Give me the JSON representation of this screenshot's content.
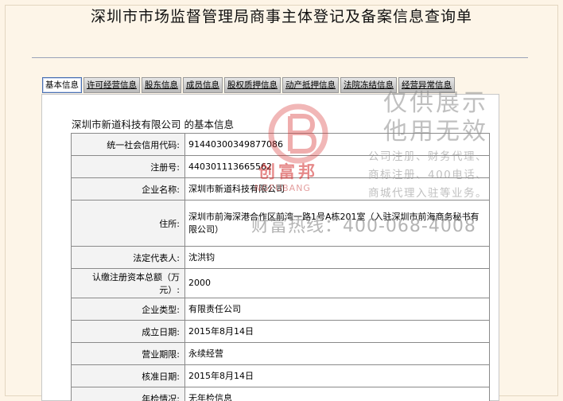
{
  "page_title": "深圳市市场监督管理局商事主体登记及备案信息查询单",
  "tabs": [
    {
      "label": "基本信息",
      "active": true
    },
    {
      "label": "许可经营信息",
      "active": false
    },
    {
      "label": "股东信息",
      "active": false
    },
    {
      "label": "成员信息",
      "active": false
    },
    {
      "label": "股权质押信息",
      "active": false
    },
    {
      "label": "动产抵押信息",
      "active": false
    },
    {
      "label": "法院冻结信息",
      "active": false
    },
    {
      "label": "经营异常信息",
      "active": false
    }
  ],
  "company_heading": "深圳市新道科技有限公司 的基本信息",
  "fields": [
    {
      "label": "统一社会信用代码:",
      "value": "91440300349877086"
    },
    {
      "label": "注册号:",
      "value": "440301113665562"
    },
    {
      "label": "企业名称:",
      "value": "深圳市新道科技有限公司"
    },
    {
      "label": "住所:",
      "value": "深圳市前海深港合作区前湾一路1号A栋201室（入驻深圳市前海商务秘书有限公司）"
    },
    {
      "label": "法定代表人:",
      "value": "沈洪钧"
    },
    {
      "label": "认缴注册资本总额（万元）:",
      "value": "2000"
    },
    {
      "label": "企业类型:",
      "value": "有限责任公司"
    },
    {
      "label": "成立日期:",
      "value": "2015年8月14日"
    },
    {
      "label": "营业期限:",
      "value": "永续经营"
    },
    {
      "label": "核准日期:",
      "value": "2015年8月14日"
    },
    {
      "label": "年检情况:",
      "value": "无年检信息"
    }
  ],
  "watermark": {
    "brand_cn": "创富邦",
    "brand_en": "NGFUBANG",
    "show_line1": "仅供展示",
    "show_line2": "他用无效",
    "services_line1": "公司注册、财务代理、",
    "services_line2": "商标注册、400电话、",
    "services_line3": "商城代理入驻等业务。",
    "hotline": "财富热线：400-068-4008",
    "color": "#d22828"
  }
}
